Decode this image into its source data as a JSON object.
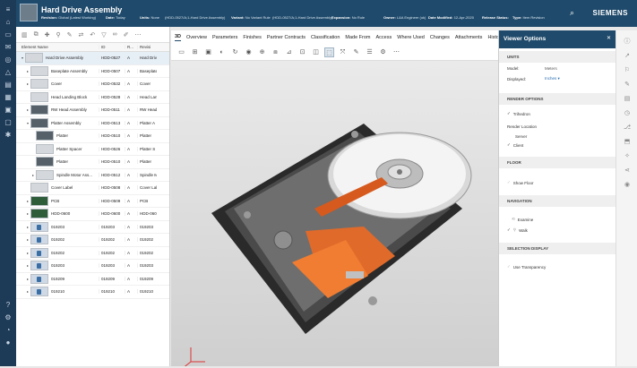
{
  "header": {
    "title": "Hard Drive Assembly",
    "meta": [
      {
        "k": "Revision:",
        "v": "Global (Latest Working)"
      },
      {
        "k": "Date:",
        "v": "Today"
      },
      {
        "k": "Units:",
        "v": "None"
      },
      {
        "k": "",
        "v": "(HDD-0527/A;1-Hard Drive Assembly)"
      },
      {
        "k": "Variant:",
        "v": "No Variant Rule"
      },
      {
        "k": "",
        "v": "(HDD-0527/A;1-Hard Drive Assembly)"
      },
      {
        "k": "Expansion:",
        "v": "No Rule"
      },
      {
        "k": "Owner:",
        "v": "L&A Engineer (ok)"
      },
      {
        "k": "Date Modified:",
        "v": "12-Apr-2020"
      },
      {
        "k": "Release Status:",
        "v": ""
      },
      {
        "k": "Type:",
        "v": "Item Revision"
      }
    ],
    "brand": "SIEMENS",
    "search_icon": "search-icon"
  },
  "tree": {
    "columns": [
      "Element Name",
      "ID",
      "R...",
      "Revisi"
    ],
    "rows": [
      {
        "exp": "▾",
        "indent": 0,
        "thumb": "light",
        "name": "Hard Drive Assembly",
        "id": "HDD-0527",
        "r": "A",
        "rev": "Hard Driv"
      },
      {
        "exp": "▸",
        "indent": 1,
        "thumb": "light",
        "name": "Baseplate Assembly",
        "id": "HDD-0507",
        "r": "A",
        "rev": "Baseplate"
      },
      {
        "exp": "▸",
        "indent": 1,
        "thumb": "light",
        "name": "Cover",
        "id": "HDD-0532",
        "r": "A",
        "rev": "Cover"
      },
      {
        "exp": "",
        "indent": 1,
        "thumb": "light",
        "name": "Head Landing Block",
        "id": "HDD-0528",
        "r": "A",
        "rev": "Head Lan"
      },
      {
        "exp": "▸",
        "indent": 1,
        "thumb": "dark",
        "name": "RW Head Assembly",
        "id": "HDD-0511",
        "r": "A",
        "rev": "RW Head"
      },
      {
        "exp": "▾",
        "indent": 1,
        "thumb": "dark",
        "name": "Platter Assembly",
        "id": "HDD-0513",
        "r": "A",
        "rev": "Platter A"
      },
      {
        "exp": "",
        "indent": 2,
        "thumb": "dark",
        "name": "Platter",
        "id": "HDD-0510",
        "r": "A",
        "rev": "Platter"
      },
      {
        "exp": "",
        "indent": 2,
        "thumb": "light",
        "name": "Platter Spacer",
        "id": "HDD-0526",
        "r": "A",
        "rev": "Platter S"
      },
      {
        "exp": "",
        "indent": 2,
        "thumb": "dark",
        "name": "Platter",
        "id": "HDD-0510",
        "r": "A",
        "rev": "Platter"
      },
      {
        "exp": "▸",
        "indent": 2,
        "thumb": "light",
        "name": "Spindle Motor Ass...",
        "id": "HDD-0512",
        "r": "A",
        "rev": "Spindle M"
      },
      {
        "exp": "",
        "indent": 1,
        "thumb": "light",
        "name": "Cover Label",
        "id": "HDD-0508",
        "r": "A",
        "rev": "Cover Lab"
      },
      {
        "exp": "▸",
        "indent": 1,
        "thumb": "green",
        "name": "PCB",
        "id": "HDD-0509",
        "r": "A",
        "rev": "PCB"
      },
      {
        "exp": "▸",
        "indent": 1,
        "thumb": "green",
        "name": "HDD-0600",
        "id": "HDD-0600",
        "r": "A",
        "rev": "HDD-060"
      },
      {
        "exp": "▸",
        "indent": 1,
        "thumb": "blue",
        "name": "019203",
        "id": "019203",
        "r": "A",
        "rev": "019203"
      },
      {
        "exp": "▸",
        "indent": 1,
        "thumb": "blue",
        "name": "019202",
        "id": "019202",
        "r": "A",
        "rev": "019202"
      },
      {
        "exp": "▸",
        "indent": 1,
        "thumb": "blue",
        "name": "019202",
        "id": "019202",
        "r": "A",
        "rev": "019202"
      },
      {
        "exp": "▸",
        "indent": 1,
        "thumb": "blue",
        "name": "019203",
        "id": "019203",
        "r": "A",
        "rev": "019203"
      },
      {
        "exp": "▸",
        "indent": 1,
        "thumb": "blue",
        "name": "019209",
        "id": "019209",
        "r": "A",
        "rev": "019209"
      },
      {
        "exp": "▸",
        "indent": 1,
        "thumb": "blue",
        "name": "019210",
        "id": "019210",
        "r": "A",
        "rev": "019210"
      }
    ]
  },
  "tabs": [
    "3D",
    "Overview",
    "Parameters",
    "Finishes",
    "Partner Contracts",
    "Classification",
    "Made From",
    "Access",
    "Where Used",
    "Changes",
    "Attachments",
    "History"
  ],
  "panel": {
    "title": "Viewer Options",
    "units_h": "UNITS",
    "model_k": "Model:",
    "model_v": "Meters",
    "displayed_k": "Displayed:",
    "displayed_v": "Inches ▾",
    "render_h": "RENDER OPTIONS",
    "trihedron": "Trihedron",
    "render_location": "Render Location",
    "server": "Server",
    "client": "Client",
    "floor_h": "FLOOR",
    "show_floor": "Show Floor",
    "nav_h": "NAVIGATION",
    "examine": "Examine",
    "walk": "Walk",
    "sel_h": "SELECTION DISPLAY",
    "use_transparency": "Use Transparency"
  }
}
